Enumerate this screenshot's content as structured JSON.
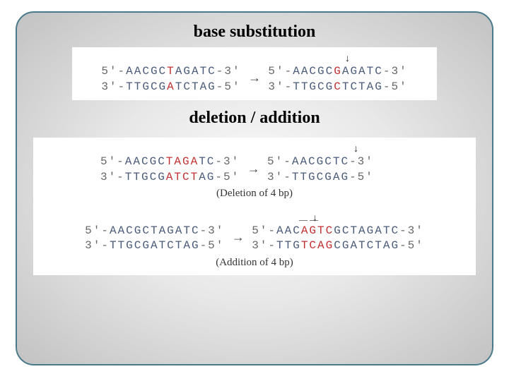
{
  "headings": {
    "substitution": "base substitution",
    "deletion_addition": "deletion / addition"
  },
  "arrow": "→",
  "marker_arrow": "↓",
  "marker_underscore": "__ __",
  "substitution": {
    "left": {
      "top": {
        "p5": "5'-",
        "pre": "AACGC",
        "mut": "T",
        "post": "AGATC",
        "p3": "-3'"
      },
      "bottom": {
        "p5": "3'-",
        "pre": "TTGCG",
        "mut": "A",
        "post": "TCTAG",
        "p3": "-5'"
      }
    },
    "right": {
      "top": {
        "p5": "5'-",
        "pre": "AACGC",
        "mut": "G",
        "post": "AGATC",
        "p3": "-3'"
      },
      "bottom": {
        "p5": "3'-",
        "pre": "TTGCG",
        "mut": "C",
        "post": "TCTAG",
        "p3": "-5'"
      }
    }
  },
  "deletion": {
    "left": {
      "top": {
        "p5": "5'-",
        "pre": "AACGC",
        "mut": "TAGA",
        "post": "TC",
        "p3": "-3'"
      },
      "bottom": {
        "p5": "3'-",
        "pre": "TTGCG",
        "mut": "ATCT",
        "post": "AG",
        "p3": "-5'"
      }
    },
    "right": {
      "top": {
        "p5": "5'-",
        "seq": "AACGCTC",
        "p3": "-3'"
      },
      "bottom": {
        "p5": "3'-",
        "seq": "TTGCGAG",
        "p3": "-5'"
      }
    },
    "caption": "(Deletion of 4 bp)"
  },
  "addition": {
    "left": {
      "top": {
        "p5": "5'-",
        "seq": "AACGCTAGATC",
        "p3": "-3'"
      },
      "bottom": {
        "p5": "3'-",
        "seq": "TTGCGATCTAG",
        "p3": "-5'"
      }
    },
    "right": {
      "top": {
        "p5": "5'-",
        "pre": "AAC",
        "mut": "AGTC",
        "post": "GCTAGATC",
        "p3": "-3'"
      },
      "bottom": {
        "p5": "3'-",
        "pre": "TTG",
        "mut": "TCAG",
        "post": "CGATCTAG",
        "p3": "-5'"
      }
    },
    "caption": "(Addition of 4 bp)"
  }
}
